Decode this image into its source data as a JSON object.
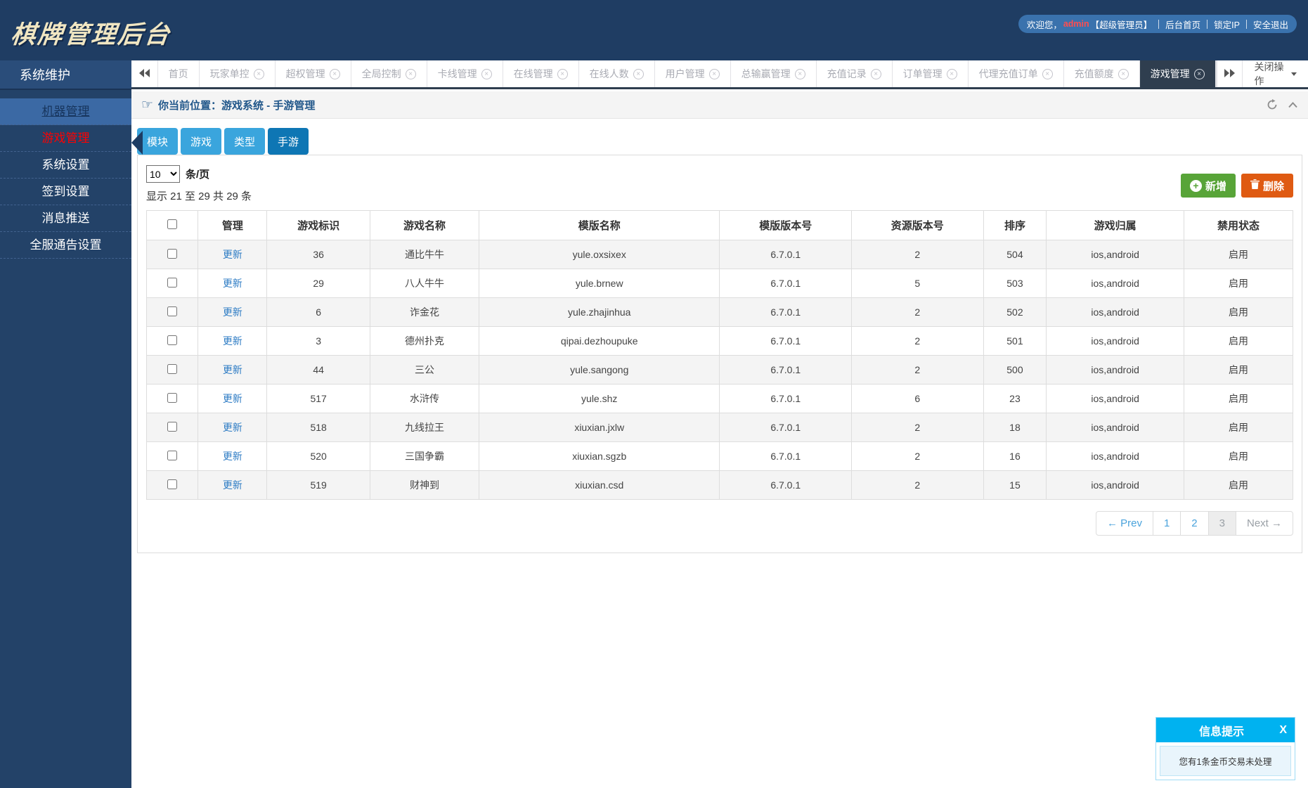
{
  "app": {
    "title": "棋牌管理后台"
  },
  "user_bar": {
    "welcome": "欢迎您，",
    "username": "admin",
    "role": "【超级管理员】",
    "links": [
      "后台首页",
      "锁定IP",
      "安全退出"
    ]
  },
  "sidebar": {
    "section_title": "系统维护",
    "items": [
      {
        "label": "机器管理",
        "state": "hl"
      },
      {
        "label": "游戏管理",
        "state": "active"
      },
      {
        "label": "系统设置"
      },
      {
        "label": "签到设置"
      },
      {
        "label": "消息推送"
      },
      {
        "label": "全服通告设置"
      }
    ]
  },
  "tabs": {
    "items": [
      {
        "label": "首页",
        "closable": false
      },
      {
        "label": "玩家单控",
        "closable": true
      },
      {
        "label": "超权管理",
        "closable": true
      },
      {
        "label": "全局控制",
        "closable": true
      },
      {
        "label": "卡线管理",
        "closable": true
      },
      {
        "label": "在线管理",
        "closable": true
      },
      {
        "label": "在线人数",
        "closable": true
      },
      {
        "label": "用户管理",
        "closable": true
      },
      {
        "label": "总输赢管理",
        "closable": true
      },
      {
        "label": "充值记录",
        "closable": true
      },
      {
        "label": "订单管理",
        "closable": true
      },
      {
        "label": "代理充值订单",
        "closable": true
      },
      {
        "label": "充值额度",
        "closable": true
      },
      {
        "label": "游戏管理",
        "closable": true,
        "active": true
      }
    ],
    "close_menu_label": "关闭操作"
  },
  "breadcrumb": {
    "label": "你当前位置：游戏系统 - 手游管理"
  },
  "subtabs": [
    {
      "label": "模块"
    },
    {
      "label": "游戏"
    },
    {
      "label": "类型"
    },
    {
      "label": "手游",
      "active": true
    }
  ],
  "controls": {
    "page_size": "10",
    "page_size_unit": "条/页",
    "summary": "显示 21 至 29 共 29 条",
    "add_label": "新增",
    "delete_label": "删除"
  },
  "table": {
    "headers": [
      "管理",
      "游戏标识",
      "游戏名称",
      "模版名称",
      "模版版本号",
      "资源版本号",
      "排序",
      "游戏归属",
      "禁用状态"
    ],
    "rows": [
      {
        "action": "更新",
        "game_id": "36",
        "name": "通比牛牛",
        "template": "yule.oxsixex",
        "template_ver": "6.7.0.1",
        "res_ver": "2",
        "sort": "504",
        "platform": "ios,android",
        "status": "启用"
      },
      {
        "action": "更新",
        "game_id": "29",
        "name": "八人牛牛",
        "template": "yule.brnew",
        "template_ver": "6.7.0.1",
        "res_ver": "5",
        "sort": "503",
        "platform": "ios,android",
        "status": "启用"
      },
      {
        "action": "更新",
        "game_id": "6",
        "name": "诈金花",
        "template": "yule.zhajinhua",
        "template_ver": "6.7.0.1",
        "res_ver": "2",
        "sort": "502",
        "platform": "ios,android",
        "status": "启用"
      },
      {
        "action": "更新",
        "game_id": "3",
        "name": "德州扑克",
        "template": "qipai.dezhoupuke",
        "template_ver": "6.7.0.1",
        "res_ver": "2",
        "sort": "501",
        "platform": "ios,android",
        "status": "启用"
      },
      {
        "action": "更新",
        "game_id": "44",
        "name": "三公",
        "template": "yule.sangong",
        "template_ver": "6.7.0.1",
        "res_ver": "2",
        "sort": "500",
        "platform": "ios,android",
        "status": "启用"
      },
      {
        "action": "更新",
        "game_id": "517",
        "name": "水浒传",
        "template": "yule.shz",
        "template_ver": "6.7.0.1",
        "res_ver": "6",
        "sort": "23",
        "platform": "ios,android",
        "status": "启用"
      },
      {
        "action": "更新",
        "game_id": "518",
        "name": "九线拉王",
        "template": "xiuxian.jxlw",
        "template_ver": "6.7.0.1",
        "res_ver": "2",
        "sort": "18",
        "platform": "ios,android",
        "status": "启用"
      },
      {
        "action": "更新",
        "game_id": "520",
        "name": "三国争霸",
        "template": "xiuxian.sgzb",
        "template_ver": "6.7.0.1",
        "res_ver": "2",
        "sort": "16",
        "platform": "ios,android",
        "status": "启用"
      },
      {
        "action": "更新",
        "game_id": "519",
        "name": "财神到",
        "template": "xiuxian.csd",
        "template_ver": "6.7.0.1",
        "res_ver": "2",
        "sort": "15",
        "platform": "ios,android",
        "status": "启用"
      }
    ]
  },
  "pagination": {
    "prev": "← Prev",
    "pages": [
      "1",
      "2",
      "3"
    ],
    "active": "3",
    "next": "Next →"
  },
  "notification": {
    "title": "信息提示",
    "close": "X",
    "message": "您有1条金币交易未处理"
  },
  "colors": {
    "brand_navy": "#1f3d63",
    "tab_active_slate": "#2f3e4f",
    "subtab_blue": "#3aa5dd",
    "subtab_active_blue": "#0e76b4",
    "add_green": "#58a438",
    "delete_orange": "#df5a12",
    "active_menu_red": "#ff0000",
    "notice_cyan": "#00b2f0",
    "link_blue": "#2c7bc4"
  }
}
